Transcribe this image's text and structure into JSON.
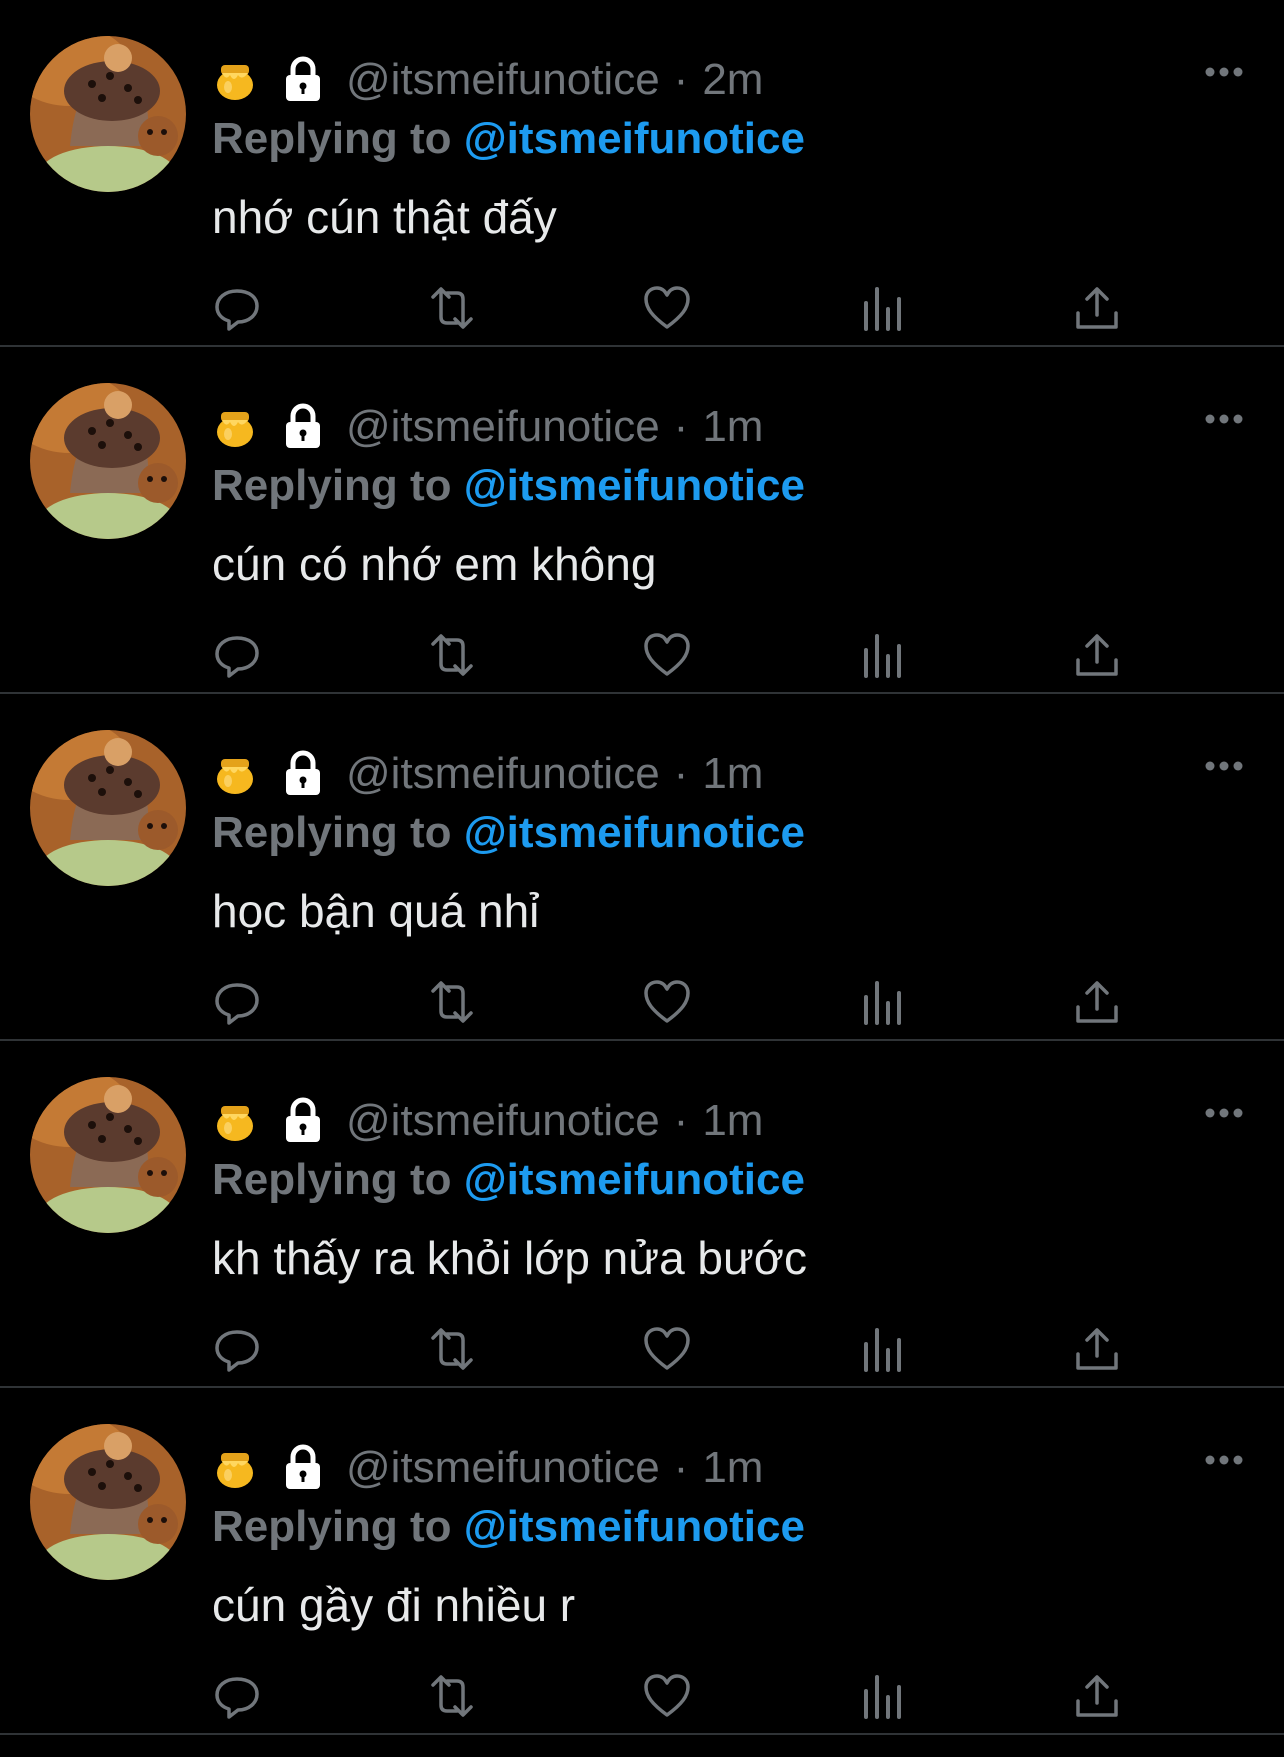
{
  "tweets": [
    {
      "emoji": "honey-pot",
      "handle": "@itsmeifunotice",
      "separator": "·",
      "time": "2m",
      "replying_label": "Replying to",
      "replying_mention": "@itsmeifunotice",
      "text": "nhớ cún thật đấy"
    },
    {
      "emoji": "honey-pot",
      "handle": "@itsmeifunotice",
      "separator": "·",
      "time": "1m",
      "replying_label": "Replying to",
      "replying_mention": "@itsmeifunotice",
      "text": "cún có nhớ em không"
    },
    {
      "emoji": "honey-pot",
      "handle": "@itsmeifunotice",
      "separator": "·",
      "time": "1m",
      "replying_label": "Replying to",
      "replying_mention": "@itsmeifunotice",
      "text": "học bận quá nhỉ"
    },
    {
      "emoji": "honey-pot",
      "handle": "@itsmeifunotice",
      "separator": "·",
      "time": "1m",
      "replying_label": "Replying to",
      "replying_mention": "@itsmeifunotice",
      "text": "kh thấy ra khỏi lớp nửa bước"
    },
    {
      "emoji": "honey-pot",
      "handle": "@itsmeifunotice",
      "separator": "·",
      "time": "1m",
      "replying_label": "Replying to",
      "replying_mention": "@itsmeifunotice",
      "text": "cún gầy đi nhiều r"
    }
  ],
  "actions": [
    "reply-icon",
    "retweet-icon",
    "like-icon",
    "views-icon",
    "share-icon"
  ],
  "colors": {
    "background": "#000000",
    "text": "#e7e9ea",
    "muted": "#71767b",
    "mention": "#1d9bf0",
    "divider": "#2f3336"
  }
}
